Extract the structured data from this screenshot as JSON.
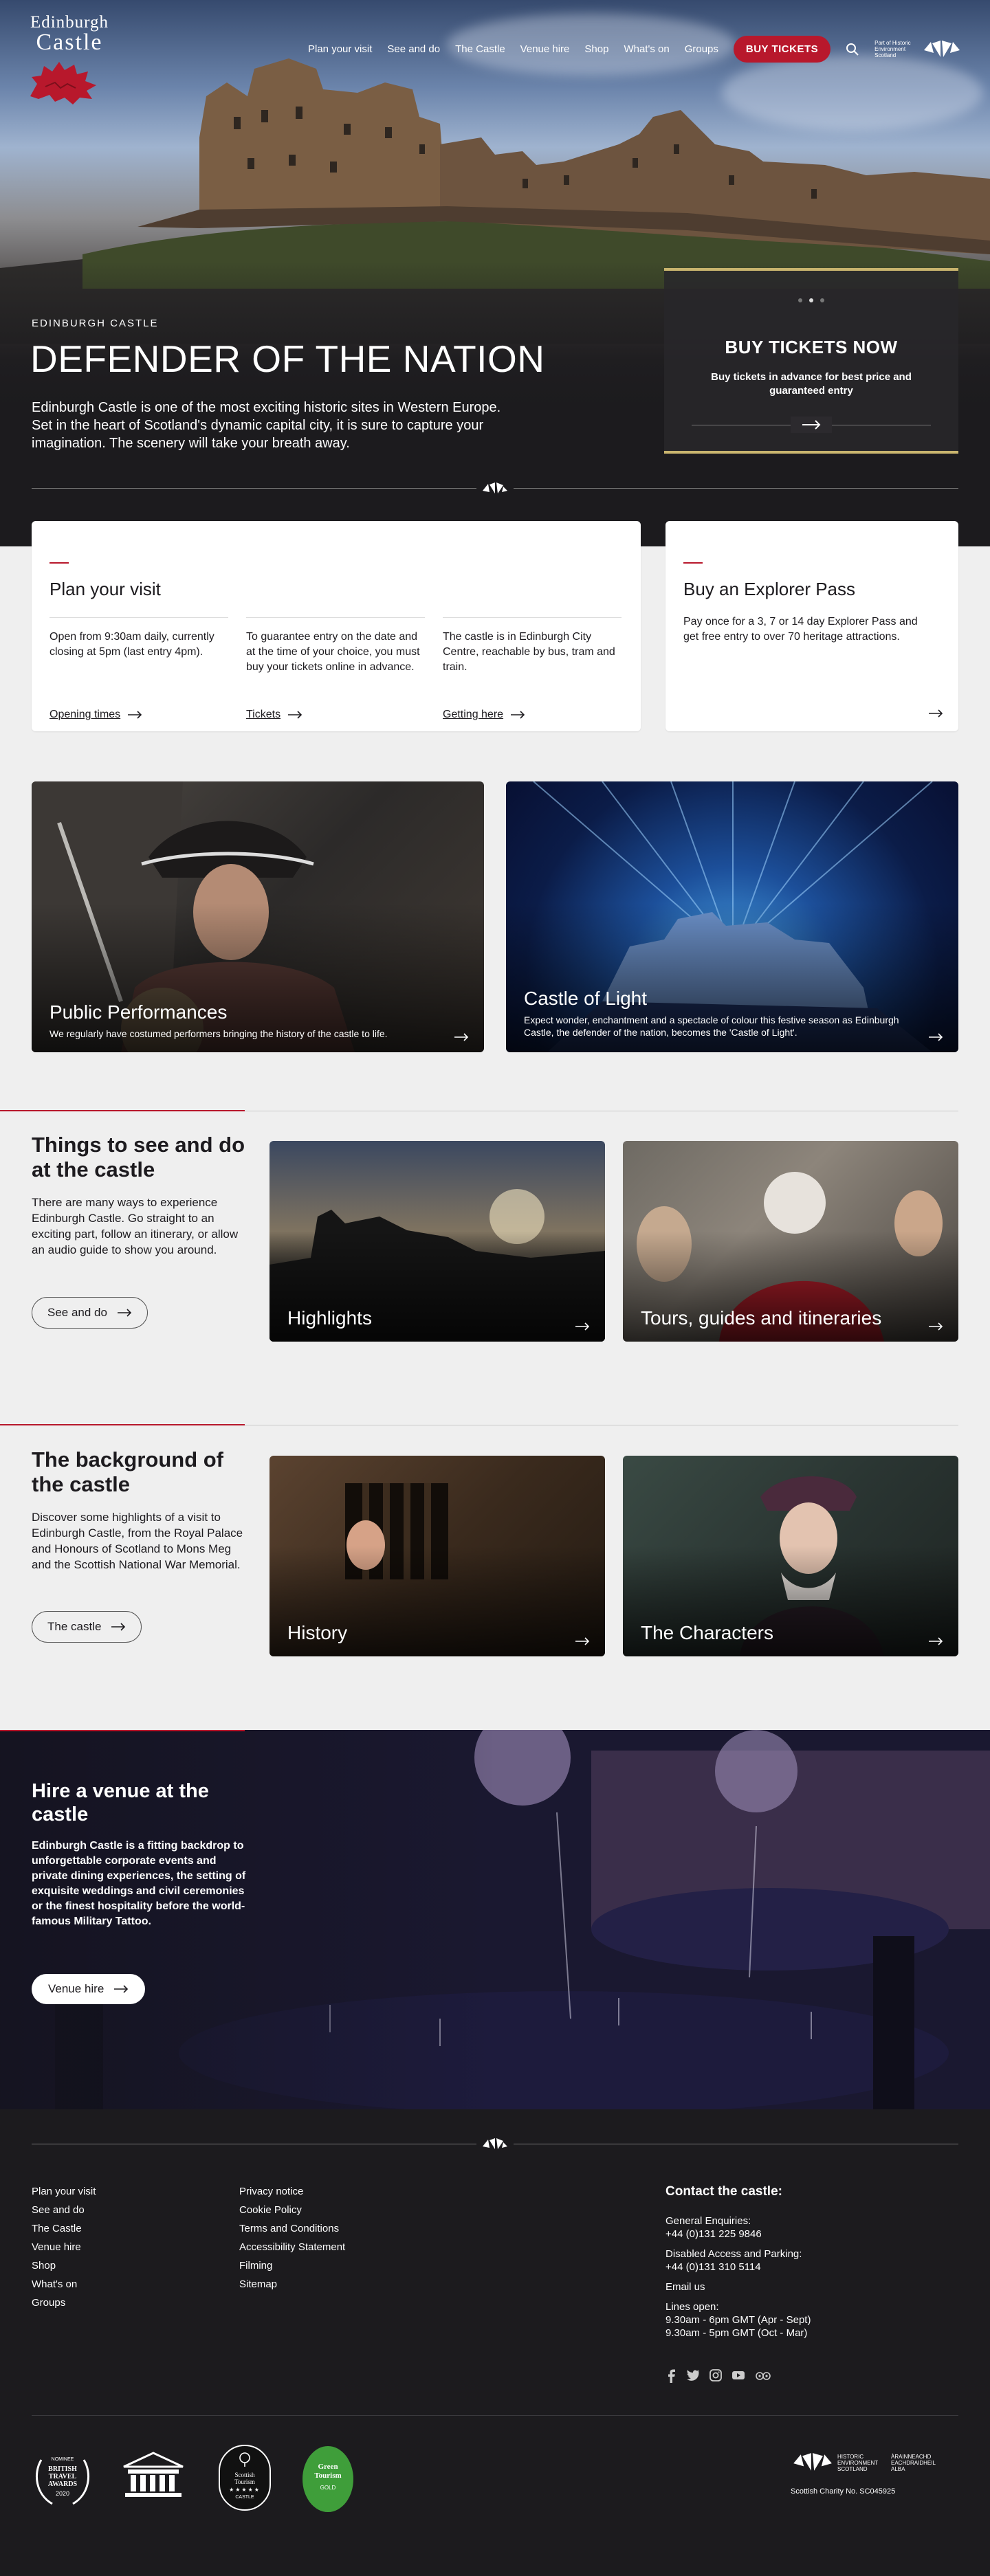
{
  "site": {
    "logo_line1": "Edinburgh",
    "logo_line2": "Castle",
    "hes_label": "Part of Historic Environment Scotland"
  },
  "nav": {
    "items": [
      "Plan your visit",
      "See and do",
      "The Castle",
      "Venue hire",
      "Shop",
      "What's on",
      "Groups"
    ],
    "tickets_button": "BUY TICKETS"
  },
  "hero": {
    "kicker": "EDINBURGH CASTLE",
    "title": "DEFENDER OF THE NATION",
    "text": "Edinburgh Castle is one of the most exciting historic sites in Western Europe. Set in the heart of Scotland's dynamic capital city, it is sure to capture your imagination. The scenery will take your breath away.",
    "buybox_title": "BUY TICKETS NOW",
    "buybox_text": "Buy tickets in advance for best price and guaranteed entry",
    "carousel_active": 1,
    "carousel_count": 3
  },
  "plan": {
    "title": "Plan your visit",
    "columns": [
      {
        "text": "Open from 9:30am daily, currently closing at 5pm (last entry 4pm).",
        "link": "Opening times"
      },
      {
        "text": "To guarantee entry on the date and at the time of your choice, you must buy your tickets online in advance.",
        "link": "Tickets"
      },
      {
        "text": "The castle is in Edinburgh City Centre, reachable by bus, tram and train.",
        "link": "Getting here"
      }
    ]
  },
  "explorer": {
    "title": "Buy an Explorer Pass",
    "text": "Pay once for a 3, 7 or 14 day Explorer Pass and get free entry to over 70 heritage attractions."
  },
  "features": [
    {
      "title": "Public Performances",
      "text": "We regularly have costumed performers bringing the history of the castle to life."
    },
    {
      "title": "Castle of Light",
      "text": "Expect wonder, enchantment and a spectacle of colour this festive season as Edinburgh Castle, the defender of the nation, becomes the 'Castle of Light'."
    }
  ],
  "things": {
    "title": "Things to see and do at the castle",
    "text": "There are many ways to experience Edinburgh Castle. Go straight to an exciting part, follow an itinerary, or allow an audio guide to show you around.",
    "button": "See and do",
    "tiles": [
      "Highlights",
      "Tours, guides and itineraries"
    ]
  },
  "background": {
    "title": "The background of the castle",
    "text": "Discover some highlights of a visit to Edinburgh Castle, from the Royal Palace and Honours of Scotland to Mons Meg and the Scottish National War Memorial.",
    "button": "The castle",
    "tiles": [
      "History",
      "The Characters"
    ]
  },
  "venue": {
    "title": "Hire a venue at the castle",
    "text": "Edinburgh Castle is a fitting backdrop to unforgettable corporate events and private dining experiences, the setting of exquisite weddings and civil ceremonies or the finest hospitality before the world-famous Military Tattoo.",
    "button": "Venue hire"
  },
  "footer": {
    "links_col1": [
      "Plan your visit",
      "See and do",
      "The Castle",
      "Venue hire",
      "Shop",
      "What's on",
      "Groups"
    ],
    "links_col2": [
      "Privacy notice",
      "Cookie Policy",
      "Terms and Conditions",
      "Accessibility Statement",
      "Filming",
      "Sitemap"
    ],
    "contact_title": "Contact the castle:",
    "general_label": "General Enquiries:",
    "general_phone": "+44 (0)131 225 9846",
    "disabled_label": "Disabled Access and Parking:",
    "disabled_phone": "+44 (0)131 310 5114",
    "email": "Email us",
    "lines_label": "Lines open:",
    "lines_summer": "9.30am - 6pm GMT (Apr - Sept)",
    "lines_winter": "9.30am - 5pm GMT (Oct - Mar)",
    "award1_top": "NOMINEE",
    "award1": "BRITISH TRAVEL AWARDS",
    "award1_year": "2020",
    "award3": "Scottish Tourism",
    "award3_sub": "CASTLE",
    "award4": "Green Tourism",
    "award4_sub": "GOLD",
    "hes_en": "HISTORIC ENVIRONMENT SCOTLAND",
    "hes_gd": "ÀRAINNEACHD EACHDRAIDHEIL ALBA",
    "charity": "Scottish Charity No. SC045925"
  },
  "colors": {
    "brand_red": "#b8182c",
    "gold": "#c9b56e",
    "dark": "#1c1b1e"
  }
}
